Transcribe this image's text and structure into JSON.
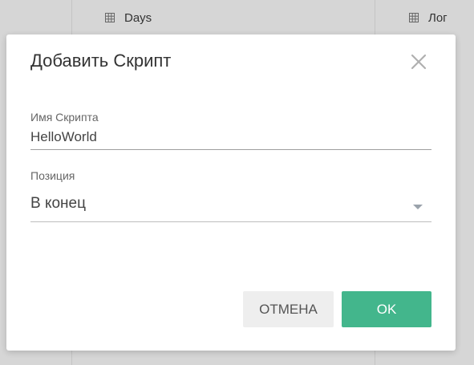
{
  "background": {
    "columns": [
      {
        "label": "Days",
        "icon": "grid-icon"
      },
      {
        "label": "Лог",
        "icon": "grid-icon"
      }
    ]
  },
  "dialog": {
    "title": "Добавить Скрипт",
    "close_icon": "close-icon",
    "name_field": {
      "label": "Имя Скрипта",
      "value": "HelloWorld"
    },
    "position_field": {
      "label": "Позиция",
      "value": "В конец"
    },
    "cancel_label": "ОТМЕНА",
    "ok_label": "OK"
  },
  "colors": {
    "accent": "#43b68c",
    "backdrop": "#d6d6d6"
  }
}
